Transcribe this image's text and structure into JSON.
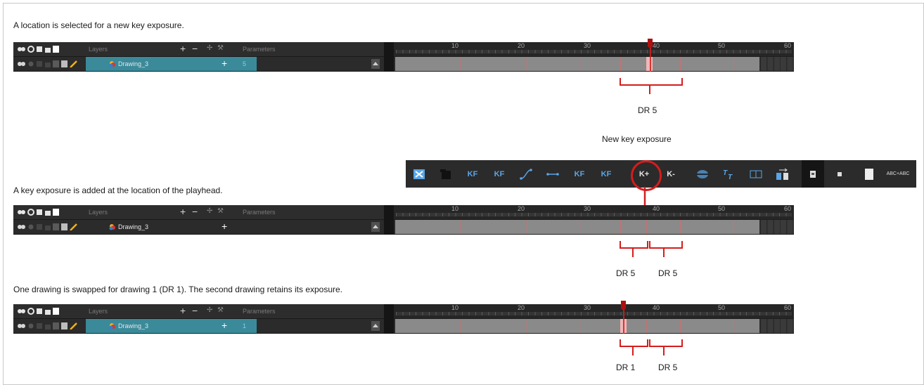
{
  "captions": {
    "first": "A location is selected for a new key exposure.",
    "second": "A key exposure is added at the location of the playhead.",
    "third": "One drawing is swapped for drawing 1 (DR 1). The second drawing retains its exposure."
  },
  "panels": [
    {
      "header_layers": "Layers",
      "header_params": "Parameters",
      "layer_name": "Drawing_3",
      "param_value": "5",
      "ruler_ticks": [
        "10",
        "20",
        "30",
        "40",
        "50",
        "60"
      ]
    },
    {
      "header_layers": "Layers",
      "header_params": "Parameters",
      "layer_name": "Drawing_3",
      "param_value": "",
      "ruler_ticks": [
        "10",
        "20",
        "30",
        "40",
        "50",
        "60"
      ]
    },
    {
      "header_layers": "Layers",
      "header_params": "Parameters",
      "layer_name": "Drawing_3",
      "param_value": "1",
      "ruler_ticks": [
        "10",
        "20",
        "30",
        "40",
        "50",
        "60"
      ]
    }
  ],
  "annotations": {
    "dr_first": "DR 5",
    "dr_second_a": "DR 5",
    "dr_second_b": "DR 5",
    "dr_third_a": "DR 1",
    "dr_third_b": "DR 5",
    "new_key_exposure": "New key exposure"
  },
  "toolbar": {
    "buttons": [
      {
        "icon": "exposure-swap-icon",
        "label": ""
      },
      {
        "icon": "clear-exposure-icon",
        "label": ""
      },
      {
        "icon": "add-keyframe-icon",
        "label": "KF"
      },
      {
        "icon": "remove-keyframe-icon",
        "label": "KF"
      },
      {
        "icon": "curve-icon",
        "label": ""
      },
      {
        "icon": "constant-segment-icon",
        "label": ""
      },
      {
        "icon": "previous-keyframe-icon",
        "label": "KF"
      },
      {
        "icon": "next-keyframe-icon",
        "label": "KF"
      },
      {
        "icon": "add-key-exposure-icon",
        "label": "K+"
      },
      {
        "icon": "remove-key-exposure-icon",
        "label": "K-"
      },
      {
        "icon": "onion-skin-icon",
        "label": ""
      },
      {
        "icon": "stagger-icon",
        "label": ""
      },
      {
        "icon": "expand-icon",
        "label": ""
      },
      {
        "icon": "fill-exposure-icon",
        "label": ""
      },
      {
        "icon": "view-small-icon",
        "label": ""
      },
      {
        "icon": "view-medium-icon",
        "label": ""
      },
      {
        "icon": "view-large-icon",
        "label": ""
      },
      {
        "icon": "rename-icon",
        "label": "ABC+ABC"
      }
    ]
  },
  "colors": {
    "accent_red": "#d41d1d",
    "layer_selected": "#3a8a9a",
    "exposure_cell": "#8a8a8a"
  }
}
